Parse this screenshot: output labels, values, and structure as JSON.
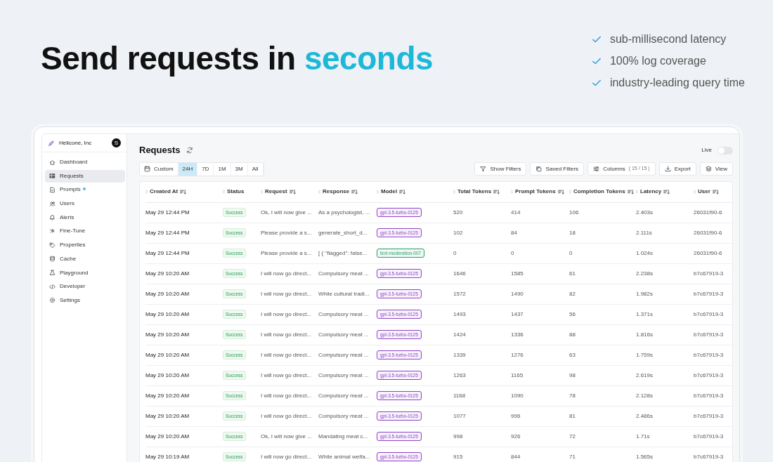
{
  "hero": {
    "headline": {
      "lead": "Send requests in",
      "accent": "seconds"
    },
    "features": [
      "sub-millisecond latency",
      "100% log coverage",
      "industry-leading query time"
    ]
  },
  "sidebar": {
    "org": "Helicone, Inc",
    "avatar": "S",
    "items": [
      {
        "label": "Dashboard",
        "selected": false,
        "dot": false
      },
      {
        "label": "Requests",
        "selected": true,
        "dot": false
      },
      {
        "label": "Prompts",
        "selected": false,
        "dot": true
      },
      {
        "label": "Users",
        "selected": false,
        "dot": false
      },
      {
        "label": "Alerts",
        "selected": false,
        "dot": false
      },
      {
        "label": "Fine-Tune",
        "selected": false,
        "dot": false
      },
      {
        "label": "Properties",
        "selected": false,
        "dot": false
      },
      {
        "label": "Cache",
        "selected": false,
        "dot": false
      },
      {
        "label": "Playground",
        "selected": false,
        "dot": false
      },
      {
        "label": "Developer",
        "selected": false,
        "dot": false
      },
      {
        "label": "Settings",
        "selected": false,
        "dot": false
      }
    ]
  },
  "page": {
    "title": "Requests",
    "live": {
      "label": "Live",
      "on": false
    },
    "ranges": [
      {
        "label": "Custom",
        "selected": false
      },
      {
        "label": "24H",
        "selected": true
      },
      {
        "label": "7D",
        "selected": false
      },
      {
        "label": "1M",
        "selected": false
      },
      {
        "label": "3M",
        "selected": false
      },
      {
        "label": "All",
        "selected": false
      }
    ],
    "actions": [
      {
        "label": "Show Filters"
      },
      {
        "label": "Saved Filters"
      },
      {
        "label": "Columns",
        "count": "( 15 / 15 )"
      },
      {
        "label": "Export"
      },
      {
        "label": "View"
      }
    ]
  },
  "table": {
    "columns": [
      {
        "label": "Created At",
        "sortable": true
      },
      {
        "label": "Status",
        "sortable": false
      },
      {
        "label": "Request",
        "sortable": true
      },
      {
        "label": "Response",
        "sortable": true
      },
      {
        "label": "Model",
        "sortable": true
      },
      {
        "label": "Total Tokens",
        "sortable": true
      },
      {
        "label": "Prompt Tokens",
        "sortable": true
      },
      {
        "label": "Completion Tokens",
        "sortable": true
      },
      {
        "label": "Latency",
        "sortable": true
      },
      {
        "label": "User",
        "sortable": true
      }
    ],
    "rows": [
      {
        "created": "May 29 12:44 PM",
        "status": "Success",
        "request": "Ok, I will now give ...",
        "response": "As a psychologist, ...",
        "model": {
          "text": "gpt-3.5-turbo-0125",
          "color": "#8e44c9"
        },
        "total": "520",
        "prompt": "414",
        "completion": "106",
        "latency": "2.403s",
        "user": "26031f90-6"
      },
      {
        "created": "May 29 12:44 PM",
        "status": "Success",
        "request": "Please provide a s...",
        "response": "generate_short_d...",
        "model": {
          "text": "gpt-3.5-turbo-0125",
          "color": "#8e44c9"
        },
        "total": "102",
        "prompt": "84",
        "completion": "18",
        "latency": "2.111s",
        "user": "26031f90-6"
      },
      {
        "created": "May 29 12:44 PM",
        "status": "Success",
        "request": "Please provide a s...",
        "response": "[ { \"flagged\": false...",
        "model": {
          "text": "text-moderation-007",
          "color": "#2a9d6a"
        },
        "total": "0",
        "prompt": "0",
        "completion": "0",
        "latency": "1.024s",
        "user": "26031f90-6"
      },
      {
        "created": "May 29 10:20 AM",
        "status": "Success",
        "request": "I will now go direct...",
        "response": "Compulsory meat ...",
        "model": {
          "text": "gpt-3.5-turbo-0125",
          "color": "#8e44c9"
        },
        "total": "1646",
        "prompt": "1585",
        "completion": "61",
        "latency": "2.238s",
        "user": "b7c67919-3"
      },
      {
        "created": "May 29 10:20 AM",
        "status": "Success",
        "request": "I will now go direct...",
        "response": "While cultural tradi...",
        "model": {
          "text": "gpt-3.5-turbo-0125",
          "color": "#8e44c9"
        },
        "total": "1572",
        "prompt": "1490",
        "completion": "82",
        "latency": "1.982s",
        "user": "b7c67919-3"
      },
      {
        "created": "May 29 10:20 AM",
        "status": "Success",
        "request": "I will now go direct...",
        "response": "Compulsory meat ...",
        "model": {
          "text": "gpt-3.5-turbo-0125",
          "color": "#8e44c9"
        },
        "total": "1493",
        "prompt": "1437",
        "completion": "56",
        "latency": "1.371s",
        "user": "b7c67919-3"
      },
      {
        "created": "May 29 10:20 AM",
        "status": "Success",
        "request": "I will now go direct...",
        "response": "Compulsory meat ...",
        "model": {
          "text": "gpt-3.5-turbo-0125",
          "color": "#8e44c9"
        },
        "total": "1424",
        "prompt": "1336",
        "completion": "88",
        "latency": "1.816s",
        "user": "b7c67919-3"
      },
      {
        "created": "May 29 10:20 AM",
        "status": "Success",
        "request": "I will now go direct...",
        "response": "Compulsory meat ...",
        "model": {
          "text": "gpt-3.5-turbo-0125",
          "color": "#8e44c9"
        },
        "total": "1339",
        "prompt": "1276",
        "completion": "63",
        "latency": "1.759s",
        "user": "b7c67919-3"
      },
      {
        "created": "May 29 10:20 AM",
        "status": "Success",
        "request": "I will now go direct...",
        "response": "Compulsory meat ...",
        "model": {
          "text": "gpt-3.5-turbo-0125",
          "color": "#8e44c9"
        },
        "total": "1263",
        "prompt": "1165",
        "completion": "98",
        "latency": "2.619s",
        "user": "b7c67919-3"
      },
      {
        "created": "May 29 10:20 AM",
        "status": "Success",
        "request": "I will now go direct...",
        "response": "Compulsory meat ...",
        "model": {
          "text": "gpt-3.5-turbo-0125",
          "color": "#8e44c9"
        },
        "total": "1168",
        "prompt": "1090",
        "completion": "78",
        "latency": "2.128s",
        "user": "b7c67919-3"
      },
      {
        "created": "May 29 10:20 AM",
        "status": "Success",
        "request": "I will now go direct...",
        "response": "Compulsory meat ...",
        "model": {
          "text": "gpt-3.5-turbo-0125",
          "color": "#8e44c9"
        },
        "total": "1077",
        "prompt": "996",
        "completion": "81",
        "latency": "2.486s",
        "user": "b7c67919-3"
      },
      {
        "created": "May 29 10:20 AM",
        "status": "Success",
        "request": "Ok, I will now give ...",
        "response": "Mandating meat c...",
        "model": {
          "text": "gpt-3.5-turbo-0125",
          "color": "#8e44c9"
        },
        "total": "998",
        "prompt": "926",
        "completion": "72",
        "latency": "1.71s",
        "user": "b7c67919-3"
      },
      {
        "created": "May 29 10:19 AM",
        "status": "Success",
        "request": "I will now go direct...",
        "response": "While animal welfa...",
        "model": {
          "text": "gpt-3.5-turbo-0125",
          "color": "#8e44c9"
        },
        "total": "915",
        "prompt": "844",
        "completion": "71",
        "latency": "1.565s",
        "user": "b7c67919-3"
      }
    ]
  }
}
